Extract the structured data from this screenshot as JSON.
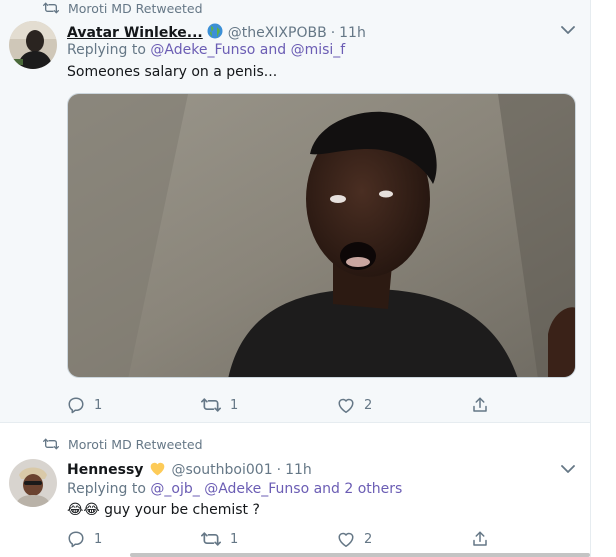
{
  "tweets": [
    {
      "retweet_label": "Moroti MD Retweeted",
      "name": "Avatar Winleke...",
      "name_emoji": "🌍",
      "handle": "@theXIXPOBB",
      "time": "11h",
      "replying_prefix": "Replying to",
      "mentions": [
        "@Adeke_Funso",
        "@misi_f"
      ],
      "mention_joiner": "and",
      "text": "Someones salary on a penis...",
      "stats": {
        "replies": "1",
        "retweets": "1",
        "likes": "2"
      }
    },
    {
      "retweet_label": "Moroti MD Retweeted",
      "name": "Hennessy",
      "name_emoji": "💛",
      "handle": "@southboi001",
      "time": "11h",
      "replying_prefix": "Replying to",
      "mentions": [
        "@_ojb_",
        "@Adeke_Funso and 2 others"
      ],
      "text_emoji": "😂😂",
      "text": "guy your be chemist ?",
      "stats": {
        "replies": "1",
        "retweets": "1",
        "likes": "2"
      }
    }
  ],
  "colors": {
    "link": "#1b95e0",
    "mention": "#6b5db4",
    "muted": "#657786",
    "bg_highlight": "#f5f8fa"
  },
  "icons": [
    "retweet-icon",
    "chevron-down-icon",
    "reply-icon",
    "like-icon",
    "share-icon"
  ]
}
